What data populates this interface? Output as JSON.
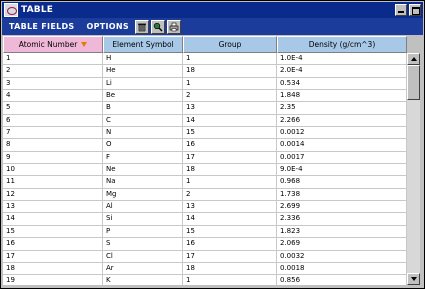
{
  "window": {
    "title": "TABLE",
    "icon": "app-icon",
    "buttons": [
      "minimize-icon",
      "maximize-icon"
    ]
  },
  "menubar": {
    "items": [
      {
        "label": "TABLE FIELDS"
      },
      {
        "label": "OPTIONS"
      }
    ],
    "tools": [
      "trash-icon",
      "search-icon",
      "print-icon"
    ]
  },
  "table": {
    "columns": [
      {
        "label": "Atomic Number",
        "sorted": true
      },
      {
        "label": "Element Symbol",
        "sorted": false
      },
      {
        "label": "Group",
        "sorted": false
      },
      {
        "label": "Density (g/cm^3)",
        "sorted": false
      }
    ],
    "rows": [
      [
        "1",
        "H",
        "1",
        "1.0E-4"
      ],
      [
        "2",
        "He",
        "18",
        "2.0E-4"
      ],
      [
        "3",
        "Li",
        "1",
        "0.534"
      ],
      [
        "4",
        "Be",
        "2",
        "1.848"
      ],
      [
        "5",
        "B",
        "13",
        "2.35"
      ],
      [
        "6",
        "C",
        "14",
        "2.266"
      ],
      [
        "7",
        "N",
        "15",
        "0.0012"
      ],
      [
        "8",
        "O",
        "16",
        "0.0014"
      ],
      [
        "9",
        "F",
        "17",
        "0.0017"
      ],
      [
        "10",
        "Ne",
        "18",
        "9.0E-4"
      ],
      [
        "11",
        "Na",
        "1",
        "0.968"
      ],
      [
        "12",
        "Mg",
        "2",
        "1.738"
      ],
      [
        "13",
        "Al",
        "13",
        "2.699"
      ],
      [
        "14",
        "Si",
        "14",
        "2.336"
      ],
      [
        "15",
        "P",
        "15",
        "1.823"
      ],
      [
        "16",
        "S",
        "16",
        "2.069"
      ],
      [
        "17",
        "Cl",
        "17",
        "0.0032"
      ],
      [
        "18",
        "Ar",
        "18",
        "0.0018"
      ],
      [
        "19",
        "K",
        "1",
        "0.856"
      ]
    ]
  },
  "colors": {
    "titlebar": "#0a2a8c",
    "menubar": "#1c3c9c",
    "header": "#a8c8e8",
    "sorted_header": "#f0b8d8",
    "sort_arrow": "#e08000"
  }
}
